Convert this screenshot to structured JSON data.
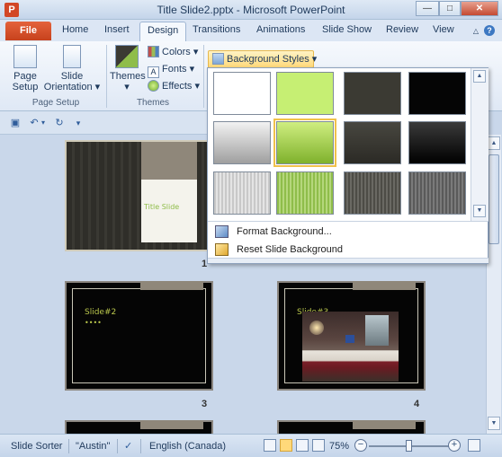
{
  "window": {
    "title": "Title Slide2.pptx - Microsoft PowerPoint",
    "app_icon_letter": "P"
  },
  "tabs": {
    "file": "File",
    "items": [
      "Home",
      "Insert",
      "Design",
      "Transitions",
      "Animations",
      "Slide Show",
      "Review",
      "View"
    ],
    "active": "Design"
  },
  "ribbon": {
    "page_setup": {
      "label": "Page\nSetup",
      "label_line1": "Page",
      "label_line2": "Setup"
    },
    "slide_orientation": {
      "label_line1": "Slide",
      "label_line2": "Orientation"
    },
    "page_setup_group": "Page Setup",
    "themes": {
      "label": "Themes"
    },
    "colors": "Colors",
    "fonts": "Fonts",
    "effects": "Effects",
    "themes_group": "Themes",
    "background_styles": "Background Styles"
  },
  "gallery": {
    "swatch_colors": [
      [
        "#ffffff",
        "#c6ef73",
        "#3b3a33",
        "#050505"
      ],
      [
        "linear-gradient(#f2f2f2,#9f9f9f)",
        "linear-gradient(#cfee80,#7fb12c)",
        "linear-gradient(#484740,#2b2a25)",
        "linear-gradient(#3a3a3a,#000000)"
      ],
      [
        "repeating-linear-gradient(90deg,#c8c8c8 0px,#c8c8c8 2px,#e4e4e4 2px,#e4e4e4 4px)",
        "repeating-linear-gradient(90deg,#8fbd4a 0px,#8fbd4a 2px,#b5d77c 2px,#b5d77c 4px)",
        "repeating-linear-gradient(90deg,#4d4c46 0px,#4d4c46 2px,#6a6963 2px,#6a6963 4px)",
        "repeating-linear-gradient(90deg,#5a5a5a 0px,#5a5a5a 2px,#7a7a7a 2px,#7a7a7a 4px)"
      ]
    ],
    "selected": [
      1,
      1
    ],
    "format_background": "Format Background...",
    "reset_background": "Reset Slide Background"
  },
  "slides": [
    {
      "number": "1",
      "title_text": "Title Slide"
    },
    {
      "number": "3",
      "line1": "Slide#2",
      "line2": "••••"
    },
    {
      "number": "4",
      "line1": "Slide#3",
      "line2": "••••"
    }
  ],
  "statusbar": {
    "view": "Slide Sorter",
    "theme": "\"Austin\"",
    "language": "English (Canada)",
    "zoom": "75%",
    "zoom_level": 0.5
  }
}
